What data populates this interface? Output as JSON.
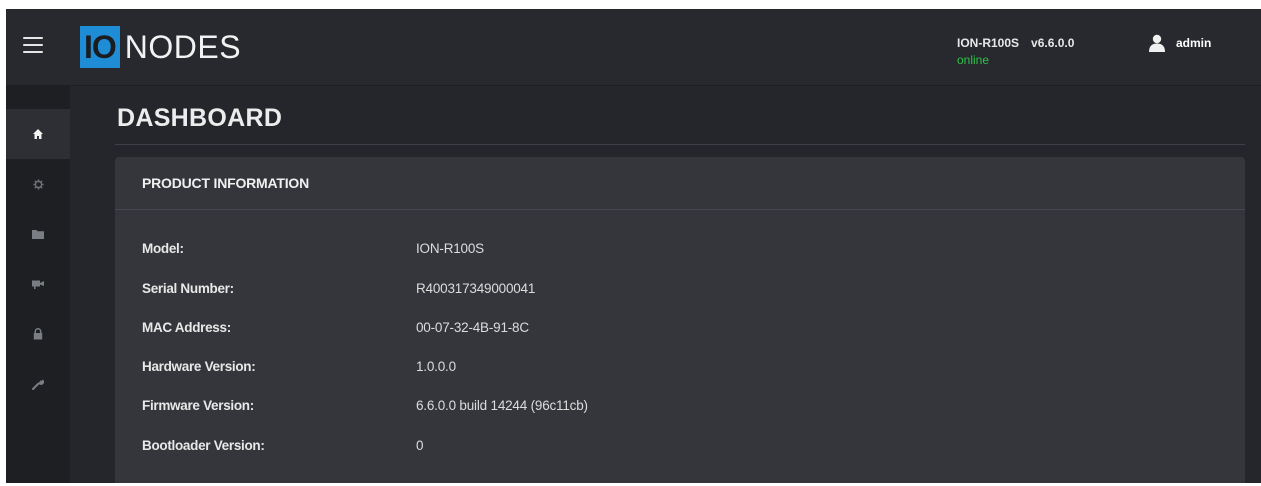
{
  "header": {
    "logo_prefix": "IO",
    "logo_suffix": "NODES",
    "device_model": "ION-R100S",
    "version": "v6.6.0.0",
    "status": "online",
    "status_color": "#2dc24a",
    "user": "admin",
    "accent_color": "#1f8dd6"
  },
  "sidebar": {
    "items": [
      {
        "icon": "home-icon",
        "active": true
      },
      {
        "icon": "gear-icon",
        "active": false
      },
      {
        "icon": "folder-icon",
        "active": false
      },
      {
        "icon": "camera-icon",
        "active": false
      },
      {
        "icon": "lock-icon",
        "active": false
      },
      {
        "icon": "wrench-icon",
        "active": false
      }
    ]
  },
  "page": {
    "title": "DASHBOARD"
  },
  "product_info": {
    "title": "PRODUCT INFORMATION",
    "rows": [
      {
        "label": "Model:",
        "value": "ION-R100S"
      },
      {
        "label": "Serial Number:",
        "value": "R400317349000041"
      },
      {
        "label": "MAC Address:",
        "value": "00-07-32-4B-91-8C"
      },
      {
        "label": "Hardware Version:",
        "value": "1.0.0.0"
      },
      {
        "label": "Firmware Version:",
        "value": "6.6.0.0 build 14244 (96c11cb)"
      },
      {
        "label": "Bootloader Version:",
        "value": "0"
      }
    ]
  }
}
